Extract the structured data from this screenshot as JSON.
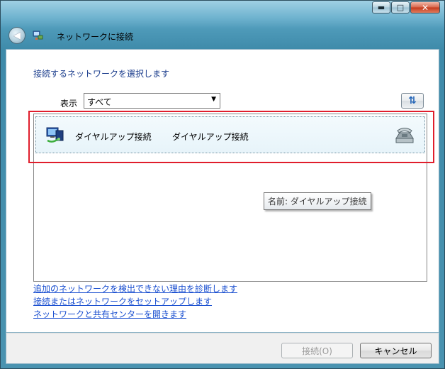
{
  "window": {
    "title": "ネットワークに接続",
    "buttons": {
      "minimize_glyph": "▬",
      "maximize_glyph": "□",
      "close_glyph": "✕"
    }
  },
  "nav": {
    "back_glyph": "◀",
    "app_icon": "network-connect-icon",
    "title": "ネットワークに接続"
  },
  "main": {
    "heading": "接続するネットワークを選択します",
    "filter": {
      "label": "表示",
      "selected": "すべて",
      "arrow_glyph": "▼"
    },
    "refresh_glyph": "⇅",
    "networks": [
      {
        "name": "ダイヤルアップ接続",
        "type": "ダイヤルアップ接続",
        "icon": "dialup-connection-icon",
        "status_icon": "telephone-icon"
      }
    ],
    "tooltip": "名前: ダイヤルアップ接続",
    "links": [
      "追加のネットワークを検出できない理由を診断します",
      "接続またはネットワークをセットアップします",
      "ネットワークと共有センターを開きます"
    ]
  },
  "footer": {
    "connect_label": "接続(O)",
    "cancel_label": "キャンセル"
  },
  "colors": {
    "link": "#1a4fd0",
    "heading": "#1a3c8c",
    "highlight": "#e01e2c"
  }
}
